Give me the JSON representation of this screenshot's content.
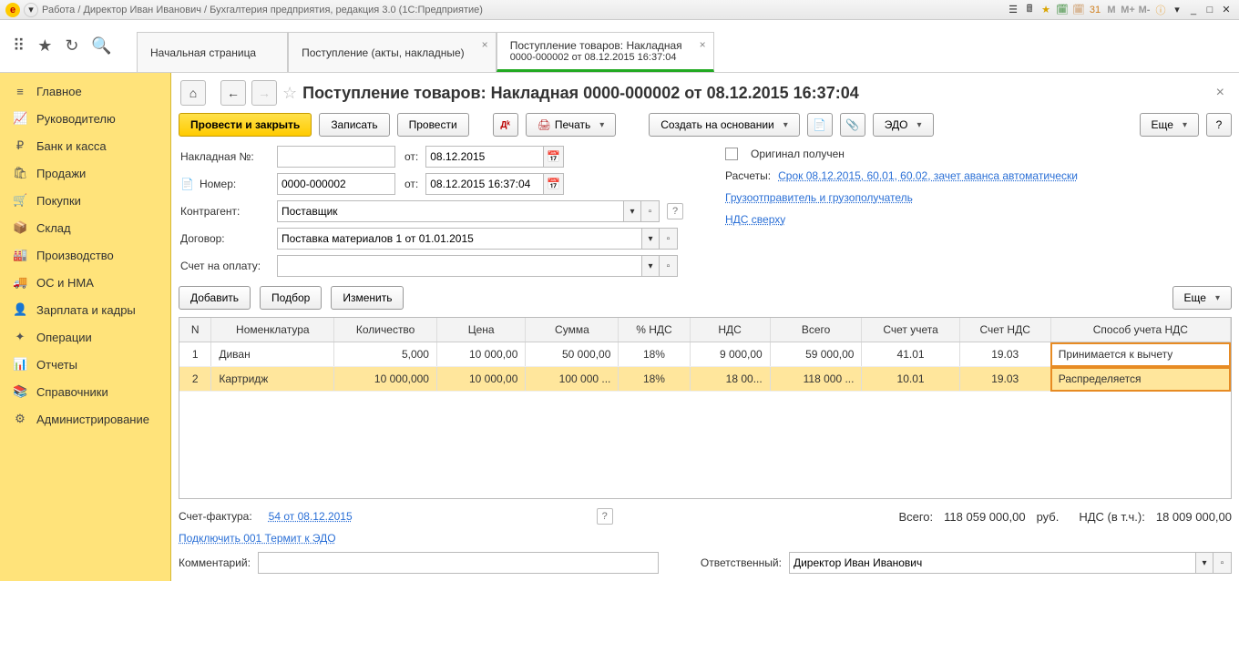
{
  "title": "Работа / Директор Иван Иванович / Бухгалтерия предприятия, редакция 3.0  (1С:Предприятие)",
  "title_right": [
    "M",
    "M+",
    "M-"
  ],
  "tabs": {
    "t1": "Начальная страница",
    "t2": "Поступление (акты, накладные)",
    "t3a": "Поступление товаров: Накладная",
    "t3b": "0000-000002 от 08.12.2015 16:37:04"
  },
  "sidebar": [
    {
      "icon": "≡",
      "label": "Главное"
    },
    {
      "icon": "📈",
      "label": "Руководителю"
    },
    {
      "icon": "₽",
      "label": "Банк и касса"
    },
    {
      "icon": "🛍",
      "label": "Продажи"
    },
    {
      "icon": "🛒",
      "label": "Покупки"
    },
    {
      "icon": "📦",
      "label": "Склад"
    },
    {
      "icon": "🏭",
      "label": "Производство"
    },
    {
      "icon": "🚚",
      "label": "ОС и НМА"
    },
    {
      "icon": "👤",
      "label": "Зарплата и кадры"
    },
    {
      "icon": "✦",
      "label": "Операции"
    },
    {
      "icon": "📊",
      "label": "Отчеты"
    },
    {
      "icon": "📚",
      "label": "Справочники"
    },
    {
      "icon": "⚙",
      "label": "Администрирование"
    }
  ],
  "page": {
    "title": "Поступление товаров: Накладная 0000-000002 от 08.12.2015 16:37:04",
    "post_and_close": "Провести и закрыть",
    "write": "Записать",
    "post": "Провести",
    "print": "Печать",
    "create_based": "Создать на основании",
    "edo": "ЭДО",
    "more": "Еще",
    "naklad_lbl": "Накладная №:",
    "from_lbl": "от:",
    "date1": "08.12.2015",
    "original_lbl": "Оригинал получен",
    "num_lbl": "Номер:",
    "num": "0000-000002",
    "dt2": "08.12.2015 16:37:04",
    "raschety_lbl": "Расчеты:",
    "raschety_link": "Срок 08.12.2015, 60.01, 60.02, зачет аванса автоматически",
    "contragent_lbl": "Контрагент:",
    "contragent": "Поставщик",
    "gruzopotpr": "Грузоотправитель и грузополучатель",
    "dogovor_lbl": "Договор:",
    "dogovor": "Поставка материалов 1 от 01.01.2015",
    "nds_link": "НДС сверху",
    "schet_lbl": "Счет на оплату:",
    "add": "Добавить",
    "pick": "Подбор",
    "change": "Изменить",
    "more2": "Еще"
  },
  "table": {
    "headers": [
      "N",
      "Номенклатура",
      "Количество",
      "Цена",
      "Сумма",
      "% НДС",
      "НДС",
      "Всего",
      "Счет учета",
      "Счет НДС",
      "Способ учета НДС"
    ],
    "rows": [
      {
        "n": "1",
        "name": "Диван",
        "qty": "5,000",
        "price": "10 000,00",
        "sum": "50 000,00",
        "pvat": "18%",
        "vat": "9 000,00",
        "total": "59 000,00",
        "acc": "41.01",
        "vacc": "19.03",
        "mode": "Принимается к вычету"
      },
      {
        "n": "2",
        "name": "Картридж",
        "qty": "10 000,000",
        "price": "10 000,00",
        "sum": "100 000 ...",
        "pvat": "18%",
        "vat": "18 00...",
        "total": "118 000 ...",
        "acc": "10.01",
        "vacc": "19.03",
        "mode": "Распределяется"
      }
    ]
  },
  "footer": {
    "sf_lbl": "Счет-фактура:",
    "sf_link": "54 от 08.12.2015",
    "edo_link": "Подключить 001 Термит к ЭДО",
    "vsego_lbl": "Всего:",
    "vsego": "118 059 000,00",
    "rub": "руб.",
    "nds_lbl": "НДС (в т.ч.):",
    "nds": "18 009 000,00",
    "comment_lbl": "Комментарий:",
    "resp_lbl": "Ответственный:",
    "resp": "Директор Иван Иванович"
  }
}
